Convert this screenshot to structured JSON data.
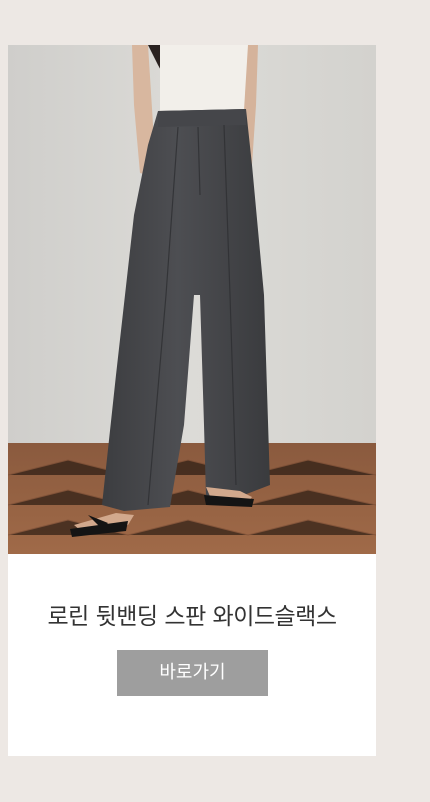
{
  "product": {
    "name": "로린 뒷밴딩 스판 와이드슬랙스",
    "buy_label": "바로가기"
  },
  "colors": {
    "page_background": "#ede8e4",
    "card_background": "#ffffff",
    "button_background": "#9e9e9e",
    "button_text": "#ffffff",
    "title_text": "#333333"
  }
}
